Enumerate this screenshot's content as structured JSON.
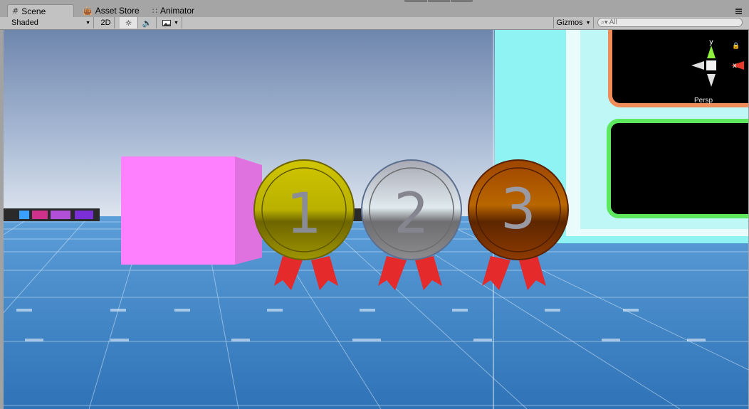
{
  "tabs": [
    {
      "label": "Scene",
      "icon": "grid-icon",
      "active": true
    },
    {
      "label": "Asset Store",
      "icon": "shopping-bag-icon",
      "active": false
    },
    {
      "label": "Animator",
      "icon": "animator-nodes-icon",
      "active": false
    }
  ],
  "toolbar": {
    "shading_mode": "Shaded",
    "mode_2d": "2D",
    "lighting_icon": "sun-icon",
    "audio_icon": "speaker-icon",
    "effects_icon": "image-icon",
    "gizmos_label": "Gizmos",
    "search_placeholder": "All",
    "search_icon": "search-icon"
  },
  "scene": {
    "medals": [
      {
        "number": "1",
        "face_color": "#b8b000",
        "ribbon_color": "#e42a2a"
      },
      {
        "number": "2",
        "face_color": "#b8bfc4",
        "ribbon_color": "#e42a2a"
      },
      {
        "number": "3",
        "face_color": "#a84d00",
        "ribbon_color": "#e42a2a"
      }
    ],
    "cube_color": "#ff80ff",
    "sky_color": "#7f97bf",
    "floor_color": "#3c7fc4",
    "panel_border_colors": [
      "#f08c5a",
      "#5de85d"
    ]
  },
  "orientation_gizmo": {
    "axis_y": "y",
    "axis_x": "x",
    "projection_label": "Persp"
  }
}
